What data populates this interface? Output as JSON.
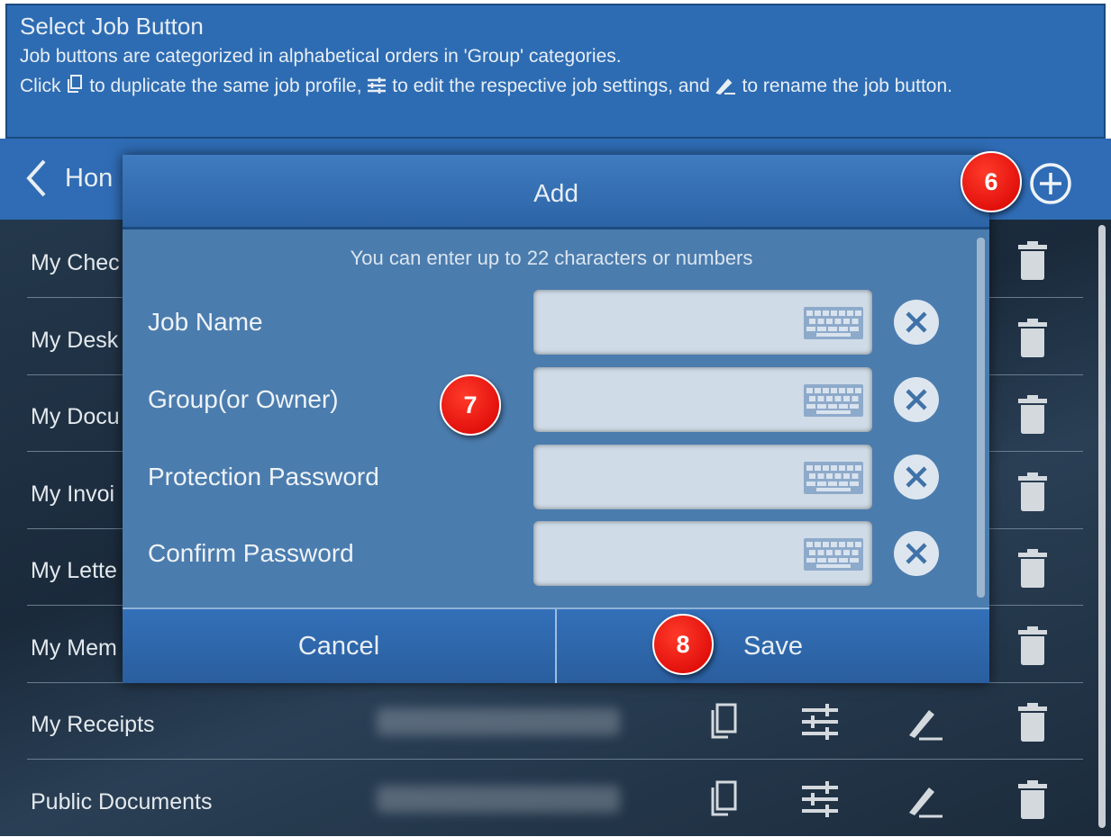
{
  "header": {
    "title": "Select Job Button",
    "line1": "Job buttons are categorized in alphabetical orders in 'Group' categories.",
    "line2_a": "Click",
    "line2_b": "to duplicate the same job profile,",
    "line2_c": "to edit the respective job settings,  and",
    "line2_d": "to rename the job button."
  },
  "nav": {
    "back_label": "Hon"
  },
  "rows": [
    {
      "label": "My Chec"
    },
    {
      "label": "My Desk"
    },
    {
      "label": "My Docu"
    },
    {
      "label": "My Invoi"
    },
    {
      "label": "My Lette"
    },
    {
      "label": "My Mem"
    },
    {
      "label": "My Receipts"
    },
    {
      "label": "Public Documents"
    }
  ],
  "dialog": {
    "title": "Add",
    "hint": "You can enter up to 22 characters or numbers",
    "fields": [
      {
        "label": "Job Name",
        "value": ""
      },
      {
        "label": "Group(or Owner)",
        "value": ""
      },
      {
        "label": "Protection Password",
        "value": ""
      },
      {
        "label": "Confirm Password",
        "value": ""
      }
    ],
    "cancel": "Cancel",
    "save": "Save"
  },
  "badges": {
    "b6": "6",
    "b7": "7",
    "b8": "8"
  },
  "colors": {
    "header": "#2d6cb3",
    "dialog": "#4b7cae",
    "badge": "#e00000"
  }
}
